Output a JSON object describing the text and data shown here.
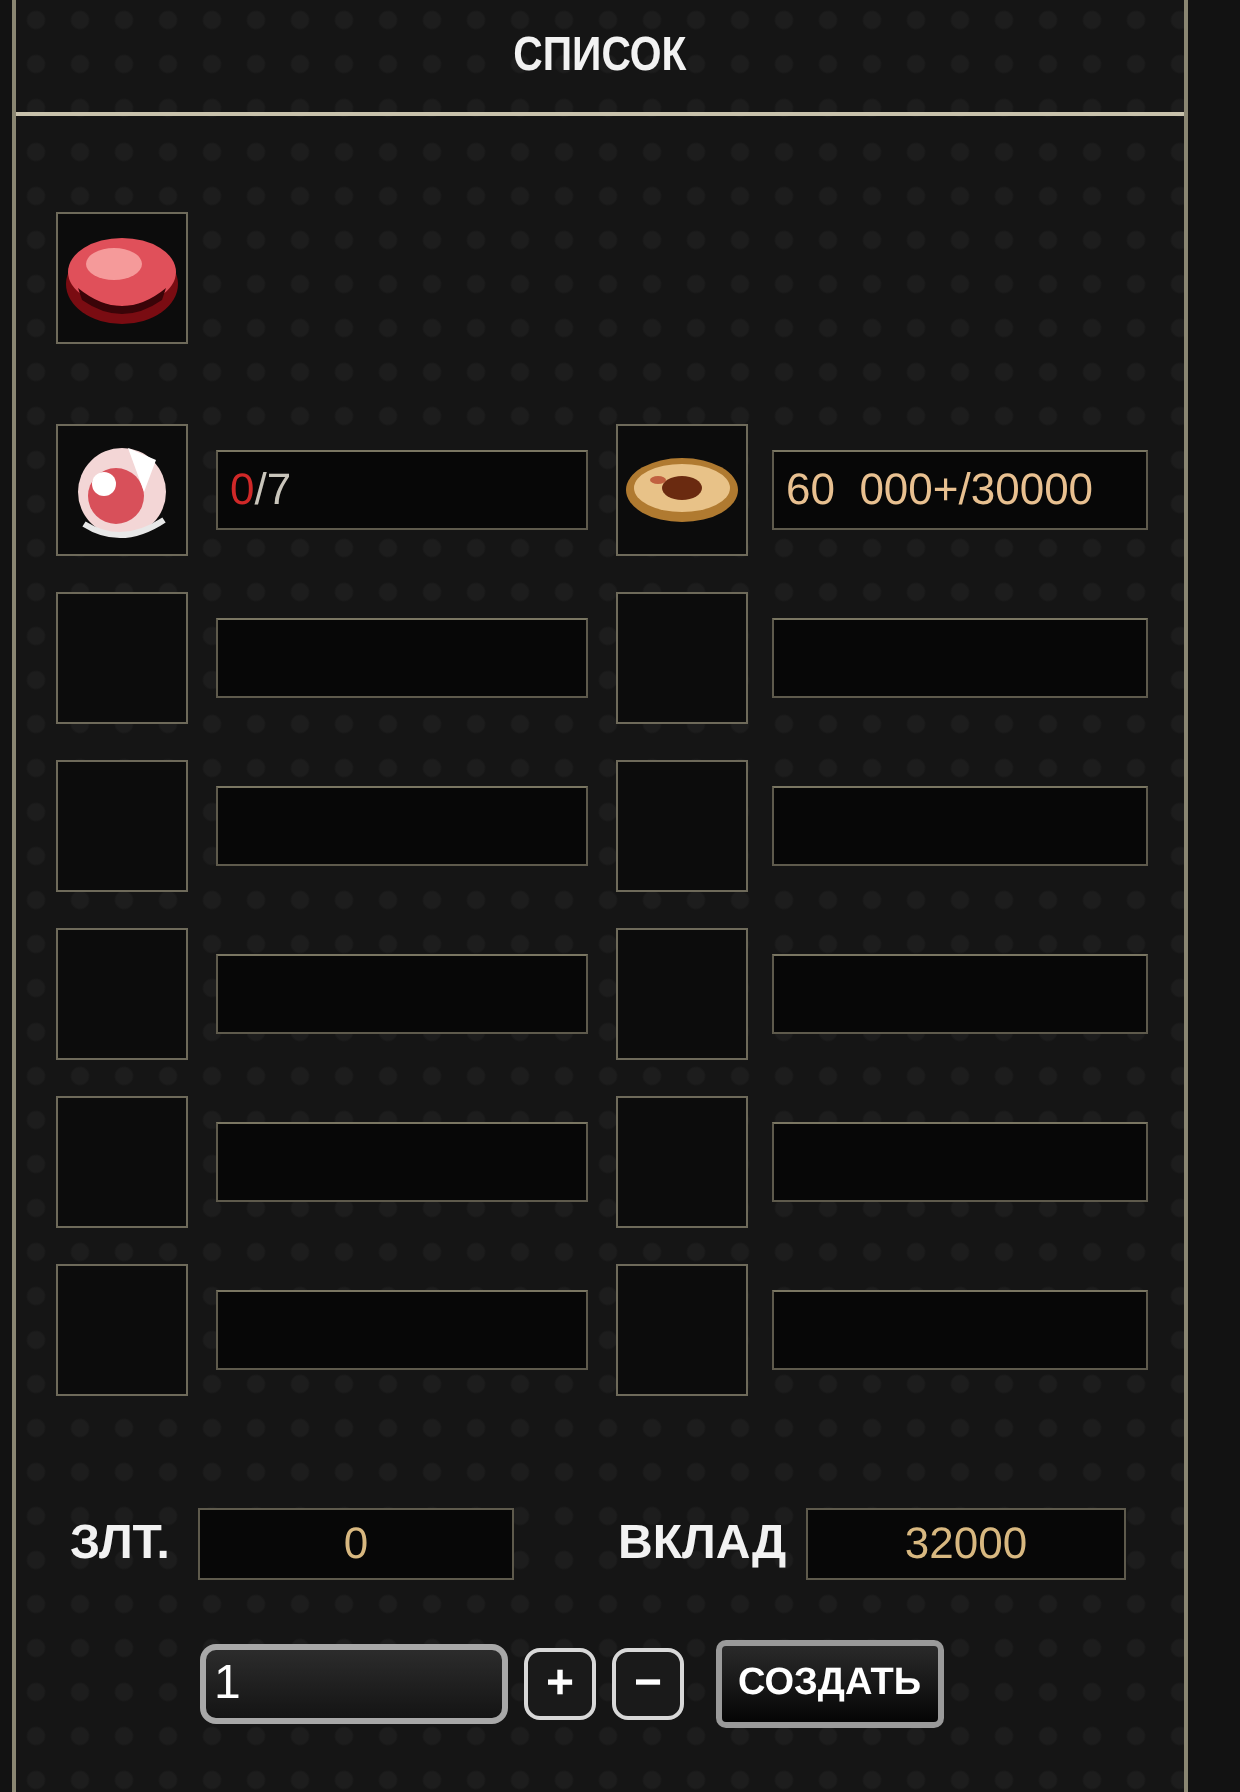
{
  "window": {
    "title": "СПИСОК"
  },
  "product": {
    "kind": "gem"
  },
  "materials": [
    {
      "kind": "crystal",
      "amount": "0",
      "required": "/7",
      "short": true
    },
    {
      "kind": "coin",
      "amount": "60  000+",
      "required": "/30000",
      "short": false
    },
    {
      "kind": "empty"
    },
    {
      "kind": "empty"
    },
    {
      "kind": "empty"
    },
    {
      "kind": "empty"
    },
    {
      "kind": "empty"
    },
    {
      "kind": "empty"
    },
    {
      "kind": "empty"
    },
    {
      "kind": "empty"
    },
    {
      "kind": "empty"
    },
    {
      "kind": "empty"
    }
  ],
  "gold": {
    "label": "ЗЛТ.",
    "value": "0"
  },
  "deposit": {
    "label": "ВКЛАД",
    "value": "32000"
  },
  "quantity": {
    "value": "1",
    "plus": "+",
    "minus": "−"
  },
  "create_button": "СОЗДАТЬ"
}
